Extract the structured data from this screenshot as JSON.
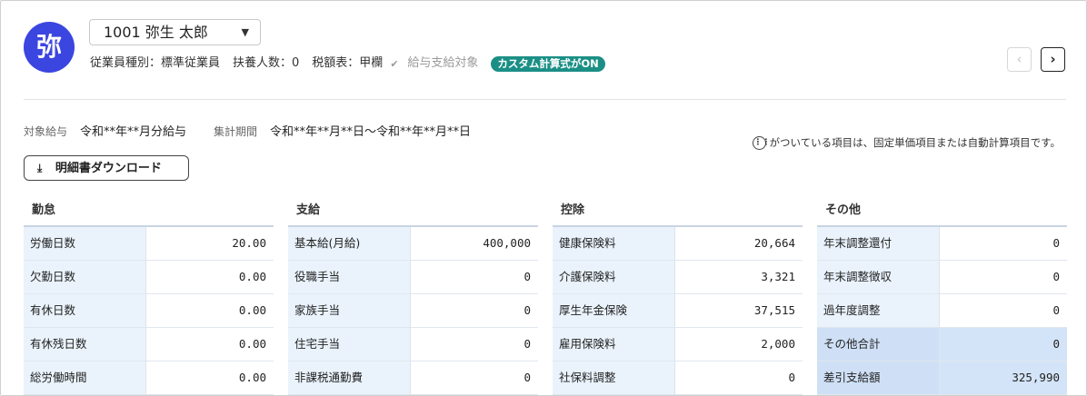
{
  "header": {
    "avatar_char": "弥",
    "employee_select": "1001 弥生 太郎",
    "employment_type": "従業員種別：標準従業員",
    "dependents": "扶養人数：0",
    "tax_table": "税額表：甲欄",
    "pay_target_label": "給与支給対象",
    "custom_badge": "カスタム計算式がON",
    "badge_color": "#1b8f86",
    "avatar_color": "#3b45e0"
  },
  "period": {
    "target_label": "対象給与",
    "target_value": "令和**年**月分給与",
    "range_label": "集計期間",
    "range_value": "令和**年**月**日〜令和**年**月**日"
  },
  "note": "がついている項目は、固定単価項目または自動計算項目です。",
  "download_label": "明細書ダウンロード",
  "sections": [
    {
      "title": "勤怠",
      "rows": [
        {
          "label": "労働日数",
          "value": "20.00"
        },
        {
          "label": "欠勤日数",
          "value": "0.00"
        },
        {
          "label": "有休日数",
          "value": "0.00"
        },
        {
          "label": "有休残日数",
          "value": "0.00"
        },
        {
          "label": "総労働時間",
          "value": "0.00"
        }
      ]
    },
    {
      "title": "支給",
      "rows": [
        {
          "label": "基本給(月給)",
          "value": "400,000"
        },
        {
          "label": "役職手当",
          "value": "0"
        },
        {
          "label": "家族手当",
          "value": "0"
        },
        {
          "label": "住宅手当",
          "value": "0"
        },
        {
          "label": "非課税通勤費",
          "value": "0"
        }
      ]
    },
    {
      "title": "控除",
      "rows": [
        {
          "label": "健康保険料",
          "value": "20,664"
        },
        {
          "label": "介護保険料",
          "value": "3,321"
        },
        {
          "label": "厚生年金保険",
          "value": "37,515"
        },
        {
          "label": "雇用保険料",
          "value": "2,000"
        },
        {
          "label": "社保料調整",
          "value": "0"
        }
      ]
    },
    {
      "title": "その他",
      "rows": [
        {
          "label": "年末調整還付",
          "value": "0"
        },
        {
          "label": "年末調整徴収",
          "value": "0"
        },
        {
          "label": "過年度調整",
          "value": "0"
        },
        {
          "label": "その他合計",
          "value": "0"
        },
        {
          "label": "差引支給額",
          "value": "325,990"
        }
      ]
    }
  ]
}
